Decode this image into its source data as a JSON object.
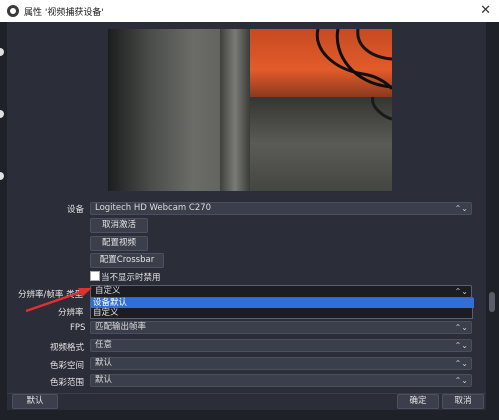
{
  "window": {
    "title": "属性 '视频捕获设备'",
    "close_glyph": "✕"
  },
  "form": {
    "device": {
      "label": "设备",
      "value": "Logitech HD Webcam C270"
    },
    "deactivate_button": "取消激活",
    "configure_video_button": "配置视频",
    "configure_crossbar_button": "配置Crossbar",
    "hide_when_not_showing_label": "当不显示时禁用",
    "resolution_fps_type": {
      "label": "分辨率/帧率 类型",
      "value": "自定义"
    },
    "resolution": {
      "label": "分辨率"
    },
    "fps": {
      "label": "FPS",
      "value": "匹配输出帧率"
    },
    "video_format": {
      "label": "视频格式",
      "value": "任意"
    },
    "color_space": {
      "label": "色彩空间",
      "value": "默认"
    },
    "color_range": {
      "label": "色彩范围",
      "value": "默认"
    }
  },
  "dropdown": {
    "options": [
      "设备默认",
      "自定义"
    ],
    "selected_index": 0
  },
  "footer": {
    "defaults_button": "默认",
    "ok_button": "确定",
    "cancel_button": "取消"
  },
  "colors": {
    "background": "#2b2e38",
    "selection": "#2f6fd6",
    "annotation_arrow": "#e03030"
  },
  "icons": {
    "combo_arrow": "⌃⌄",
    "app_icon": "obs-logo-icon"
  }
}
